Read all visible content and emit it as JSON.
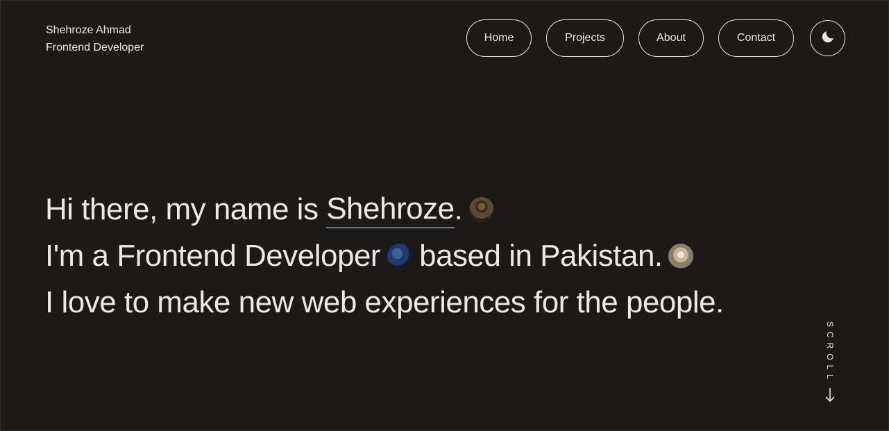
{
  "header": {
    "name": "Shehroze Ahmad",
    "role": "Frontend Developer"
  },
  "nav": {
    "items": [
      {
        "label": "Home"
      },
      {
        "label": "Projects"
      },
      {
        "label": "About"
      },
      {
        "label": "Contact"
      }
    ],
    "theme_icon": "moon-icon"
  },
  "hero": {
    "line1_prefix": "Hi there, my name is ",
    "line1_name": "Shehroze",
    "line1_suffix": ".",
    "line2_prefix": "I'm a Frontend Developer",
    "line2_suffix": "based in Pakistan.",
    "line3": "I love to make new web experiences for the people."
  },
  "scroll": {
    "label": "SCROLL",
    "arrow_icon": "arrow-down-icon"
  },
  "colors": {
    "background": "#1c1a19",
    "text": "#ece9e4",
    "underline": "#6f7a86"
  }
}
